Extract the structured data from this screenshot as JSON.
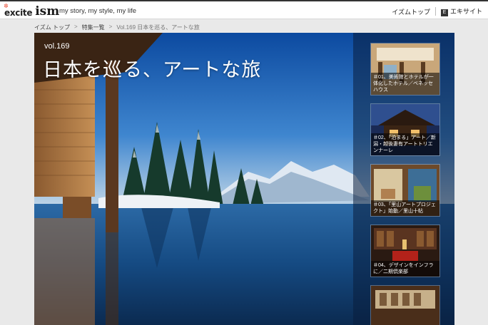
{
  "header": {
    "logo_excite": "excite",
    "logo_ism": "ism",
    "tagline": "my story, my style, my life",
    "nav_top": "イズムトップ",
    "nav_excite": "エキサイト",
    "nav_excite_icon_glyph": "E"
  },
  "breadcrumb": {
    "home": "イズム トップ",
    "section": "特集一覧",
    "current": "Vol.169 日本を巡る、アートな旅",
    "separator": ">"
  },
  "hero": {
    "vol": "vol.169",
    "title": "日本を巡る、アートな旅"
  },
  "articles": [
    {
      "caption": "＃01、美術館とホテルが一体化したホテル／ベネッセハウス"
    },
    {
      "caption": "＃02、「泊まる」アート／新潟・越後妻有アートトリエンナーレ"
    },
    {
      "caption": "＃03、「里山アートプロジェクト」始動／里山十帖"
    },
    {
      "caption": "＃04、デザインをインフラに／二期倶楽部"
    },
    {
      "caption": ""
    }
  ],
  "colors": {
    "accent_red": "#e83a1f",
    "sky_blue": "#1f6fc1",
    "water_dark": "#0d2c52"
  }
}
